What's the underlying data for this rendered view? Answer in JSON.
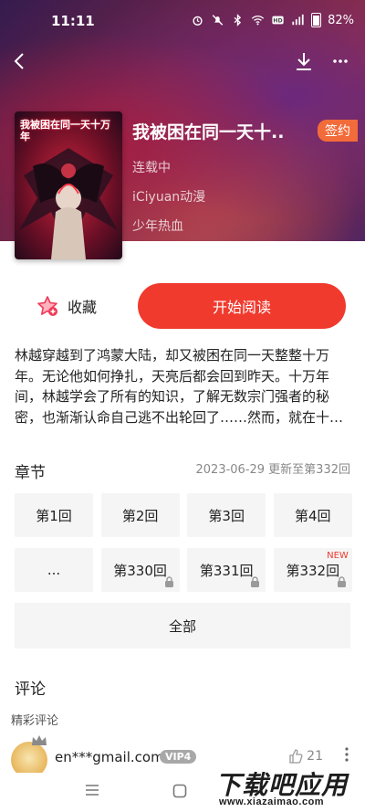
{
  "status_bar": {
    "time": "11:11",
    "battery": "82%"
  },
  "book": {
    "title": "我被困在同一天十..",
    "status": "连载中",
    "publisher": "iCiyuan动漫",
    "genre": "少年热血",
    "badge": "签约",
    "cover_text": "我被困在同一天十万年"
  },
  "actions": {
    "favorite_label": "收藏",
    "read_label": "开始阅读"
  },
  "synopsis": "林越穿越到了鸿蒙大陆，却又被困在同一天整整十万年。无论他如何挣扎，天亮后都会回到昨天。十万年间，林越学会了所有的知识，了解无数宗门强者的秘密，也渐渐认命自己逃不出轮回了……然而，就在十…",
  "chapters": {
    "title": "章节",
    "update_text": "2023-06-29 更新至第332回",
    "items": [
      {
        "label": "第1回",
        "locked": false,
        "new": ""
      },
      {
        "label": "第2回",
        "locked": false,
        "new": ""
      },
      {
        "label": "第3回",
        "locked": false,
        "new": ""
      },
      {
        "label": "第4回",
        "locked": false,
        "new": ""
      },
      {
        "label": "...",
        "locked": false,
        "new": ""
      },
      {
        "label": "第330回",
        "locked": true,
        "new": ""
      },
      {
        "label": "第331回",
        "locked": true,
        "new": ""
      },
      {
        "label": "第332回",
        "locked": true,
        "new": "NEW"
      }
    ],
    "all_label": "全部"
  },
  "comments": {
    "title": "评论",
    "subtitle": "精彩评论",
    "first": {
      "user": "en***gmail.com",
      "vip": "VIP4",
      "likes": "21"
    }
  },
  "watermark": {
    "main": "下载吧应用",
    "url": "www.xiazaimao.com"
  },
  "colors": {
    "accent": "#f03a2e",
    "badge": "#f26b3a"
  }
}
